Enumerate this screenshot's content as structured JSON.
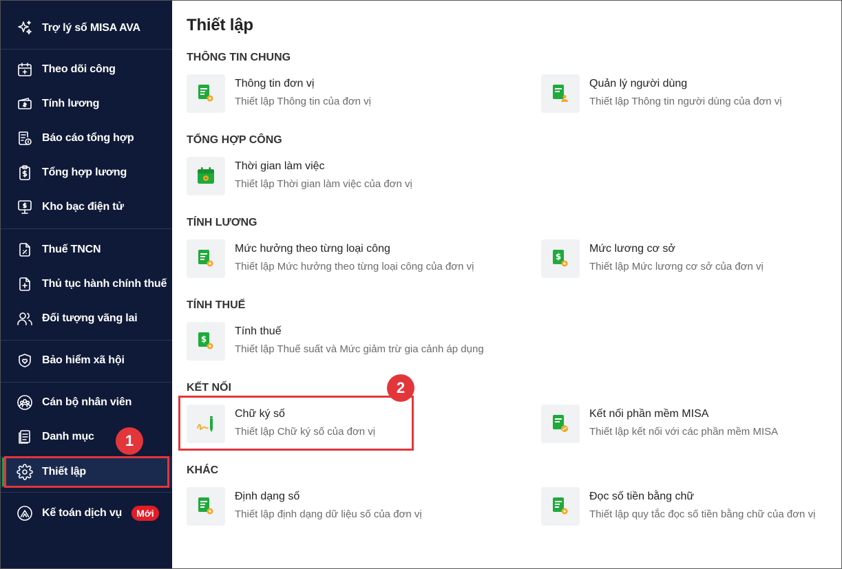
{
  "sidebar": {
    "items": [
      {
        "label": "Trợ lý số MISA AVA",
        "icon": "sparkle-icon"
      },
      {
        "label": "Theo dõi công",
        "icon": "calendar-icon"
      },
      {
        "label": "Tính lương",
        "icon": "money-icon"
      },
      {
        "label": "Báo cáo tổng hợp",
        "icon": "report-icon"
      },
      {
        "label": "Tổng hợp lương",
        "icon": "clipboard-dollar-icon"
      },
      {
        "label": "Kho bạc điện tử",
        "icon": "monitor-dollar-icon"
      },
      {
        "label": "Thuế TNCN",
        "icon": "tax-doc-icon"
      },
      {
        "label": "Thủ tục hành chính thuế",
        "icon": "doc-plus-icon"
      },
      {
        "label": "Đối tượng vãng lai",
        "icon": "users-icon"
      },
      {
        "label": "Bảo hiểm xã hội",
        "icon": "shield-heart-icon"
      },
      {
        "label": "Cán bộ nhân viên",
        "icon": "group-icon"
      },
      {
        "label": "Danh mục",
        "icon": "list-doc-icon"
      },
      {
        "label": "Thiết lập",
        "icon": "gear-icon"
      },
      {
        "label": "Kế toán dịch vụ",
        "icon": "accounting-logo-icon",
        "badge": "Mới"
      }
    ]
  },
  "page": {
    "title": "Thiết lập"
  },
  "sections": [
    {
      "title": "THÔNG TIN CHUNG",
      "cards": [
        {
          "title": "Thông tin đơn vị",
          "desc": "Thiết lập Thông tin của đơn vị",
          "icon": "doc-gear-icon"
        },
        {
          "title": "Quản lý người dùng",
          "desc": "Thiết lập Thông tin người dùng của đơn vị",
          "icon": "doc-user-icon"
        }
      ]
    },
    {
      "title": "TỔNG HỢP CÔNG",
      "cards": [
        {
          "title": "Thời gian làm việc",
          "desc": "Thiết lập Thời gian làm việc của đơn vị",
          "icon": "calendar-gear-icon"
        }
      ]
    },
    {
      "title": "TÍNH LƯƠNG",
      "cards": [
        {
          "title": "Mức hưởng theo từng loại công",
          "desc": "Thiết lập Mức hưởng theo từng loại công của đơn vị",
          "icon": "doc-gear-icon"
        },
        {
          "title": "Mức lương cơ sở",
          "desc": "Thiết lập Mức lương cơ sở của đơn vị",
          "icon": "doc-dollar-gear-icon"
        }
      ]
    },
    {
      "title": "TÍNH THUẾ",
      "cards": [
        {
          "title": "Tính thuế",
          "desc": "Thiết lập Thuế suất và Mức giảm trừ gia cảnh áp dụng",
          "icon": "doc-dollar-gear-icon"
        }
      ]
    },
    {
      "title": "KẾT NỐI",
      "cards": [
        {
          "title": "Chữ ký số",
          "desc": "Thiết lập Chữ ký số của đơn vị",
          "icon": "signature-icon"
        },
        {
          "title": "Kết nối phần mềm MISA",
          "desc": "Thiết lập kết nối với các phần mềm MISA",
          "icon": "doc-link-icon"
        }
      ]
    },
    {
      "title": "KHÁC",
      "cards": [
        {
          "title": "Định dạng số",
          "desc": "Thiết lập định dạng dữ liệu số của đơn vị",
          "icon": "doc-gear-icon"
        },
        {
          "title": "Đọc số tiền bằng chữ",
          "desc": "Thiết lập quy tắc đọc số tiền bằng chữ của đơn vị",
          "icon": "doc-gear-icon"
        }
      ]
    }
  ],
  "annotations": {
    "step1": "1",
    "step2": "2"
  },
  "colors": {
    "sidebar_bg": "#0f1a38",
    "accent_green": "#16a34a",
    "highlight_red": "#e3363b",
    "icon_green": "#1faa3b",
    "icon_orange": "#f5a623"
  }
}
